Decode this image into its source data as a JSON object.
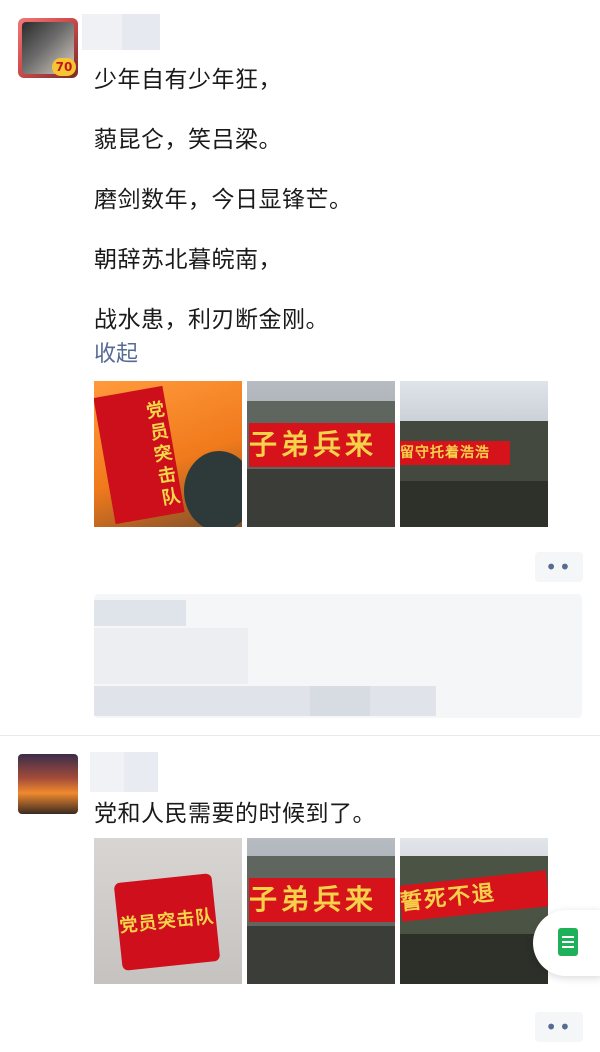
{
  "post1": {
    "lines": [
      "少年自有少年狂，",
      "藐昆仑，笑吕梁。",
      "磨剑数年，今日显锋芒。",
      "朝辞苏北暮皖南，",
      "战水患，利刃断金刚。"
    ],
    "collapse_label": "收起",
    "avatar_badge": "70",
    "images": [
      {
        "alt": "党员突击队 orange life vest with red sash",
        "text": "党员突击队"
      },
      {
        "alt": "truck with red banner",
        "text": "子弟兵来"
      },
      {
        "alt": "convoy of trucks with red banners",
        "text": "留守托着浩浩"
      }
    ],
    "more_icon": "••"
  },
  "post2": {
    "text": "党和人民需要的时候到了。",
    "images": [
      {
        "alt": "red armband",
        "text": "党员突击队"
      },
      {
        "alt": "truck with red banner",
        "text": "子弟兵来"
      },
      {
        "alt": "truck with red banner",
        "text": "誓死不退"
      }
    ],
    "more_icon": "••"
  },
  "colors": {
    "link": "#576b95",
    "banner": "#d6121b",
    "banner_text": "#f6d24a",
    "float_icon": "#1fb05a"
  }
}
